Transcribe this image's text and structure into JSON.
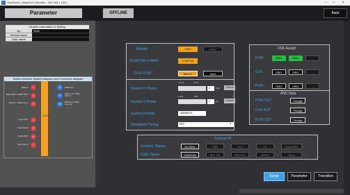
{
  "window": {
    "title": "OneRack2_SetupGUI [ Monitor : 192.168.1.100 ]",
    "min": "—",
    "max": "□",
    "close": "✕"
  },
  "header": {
    "title": "Parameter",
    "status": "OFFLINE",
    "back": "Back"
  },
  "module_info": {
    "heading": "Module Information & Setting",
    "rows": [
      {
        "key": "No",
        "value": "Slot1"
      },
      {
        "key": "Module name",
        "value": ""
      },
      {
        "key": "User name",
        "value": ""
      }
    ]
  },
  "switch": {
    "heading": "Switch between System diagram and Connector diagram",
    "left": [
      {
        "label": "Base in",
        "n": "1"
      },
      {
        "label": "Base Fill in / Main Fill in",
        "n": "2"
      },
      {
        "label": "PVW in / Main Key in",
        "n": "3"
      },
      {
        "label": "Key1 Fill in",
        "n": "4"
      },
      {
        "label": "Key1 Key in",
        "n": "5"
      },
      {
        "label": "Key2 Fill in",
        "n": "6"
      },
      {
        "label": "Key2 Key in",
        "n": "7"
      }
    ],
    "right": [
      {
        "label": "PGM out",
        "n": "8"
      },
      {
        "label": "Clean out / Main Fill out",
        "n": "9"
      },
      {
        "label": "PVW out / Main Key out",
        "n": "10"
      }
    ],
    "core": "SWITCH"
  },
  "modules": {
    "label": "Module",
    "opt1": "DSKK",
    "opt2": "DSKK",
    "cln_label": "CLN/PVW or NAM",
    "cln_val": "CLN/PVW",
    "cln2_label": "CLN / PVW",
    "basein": "Base-In",
    "input": "Input"
  },
  "dsk_assign": {
    "title": "DSK Assign",
    "rows": [
      {
        "label": "PGM",
        "a": "DSK1",
        "b": "DSK2",
        "c": "----"
      },
      {
        "label": "CLN",
        "a": "DSK1",
        "b": "DSK2",
        "c": "----"
      },
      {
        "label": "PVW",
        "a": "DSK1",
        "b": "DSK2",
        "c": "----"
      }
    ]
  },
  "system": {
    "hphase_label": "System H Phase",
    "hphase_val": "0",
    "hphase_unit": "pixel",
    "vphase_label": "System V Phase",
    "vphase_val": "0",
    "vphase_unit": "line",
    "default": "Default",
    "format_label": "System Format",
    "format_val": "1080i/59.94",
    "timing_label": "Simulation Timing",
    "timing_val": "REF",
    "tick_a": "-1L/4L",
    "tick_b": "1L/4L",
    "tick_c": "+1ML",
    "tick_d": "-1ML"
  },
  "anc": {
    "title": "ANC Data",
    "rows": [
      {
        "label": "PGM OUT",
        "val": "Through"
      },
      {
        "label": "CLN OUT",
        "val": "Through"
      },
      {
        "label": "PVW OUT",
        "val": "Through"
      }
    ]
  },
  "payload": {
    "title": "Payload ID",
    "dr_label": "Dynamic Range",
    "dr_opts": [
      "thru/Write",
      "SDR",
      "HLG",
      "PQ",
      "Unspecified"
    ],
    "cs_label": "Color Space",
    "cs_opts": [
      "UNDEFINE",
      "REC 709",
      "2020 NCL",
      "2020CL",
      "CIExyz"
    ]
  },
  "tabs": {
    "setup": "Setup",
    "parameter": "Parameter",
    "transition": "Transition"
  }
}
